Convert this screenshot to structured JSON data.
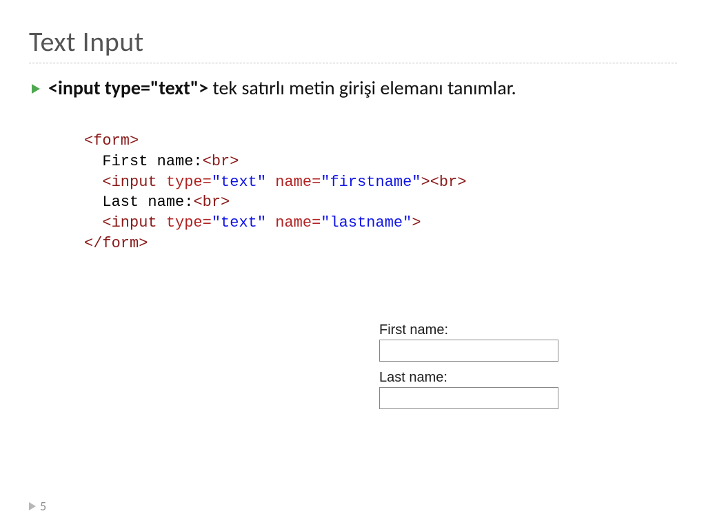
{
  "title": "Text Input",
  "bullet": {
    "code": "<input type=\"text\">",
    "description": " tek satırlı metin girişi elemanı tanımlar."
  },
  "codeSnippet": {
    "line1_open": "<form>",
    "line2": "  First name:",
    "line2_br": "<br>",
    "line3_pre": "  ",
    "line3_tag_open": "<input",
    "line3_attr1": " type=",
    "line3_val1": "\"text\"",
    "line3_attr2": " name=",
    "line3_val2": "\"firstname\"",
    "line3_tag_close": ">",
    "line3_br": "<br>",
    "line4": "  Last name:",
    "line4_br": "<br>",
    "line5_pre": "  ",
    "line5_tag_open": "<input",
    "line5_attr1": " type=",
    "line5_val1": "\"text\"",
    "line5_attr2": " name=",
    "line5_val2": "\"lastname\"",
    "line5_tag_close": ">",
    "line6_close": "</form>"
  },
  "preview": {
    "label1": "First name:",
    "label2": "Last name:"
  },
  "pageNumber": "5"
}
